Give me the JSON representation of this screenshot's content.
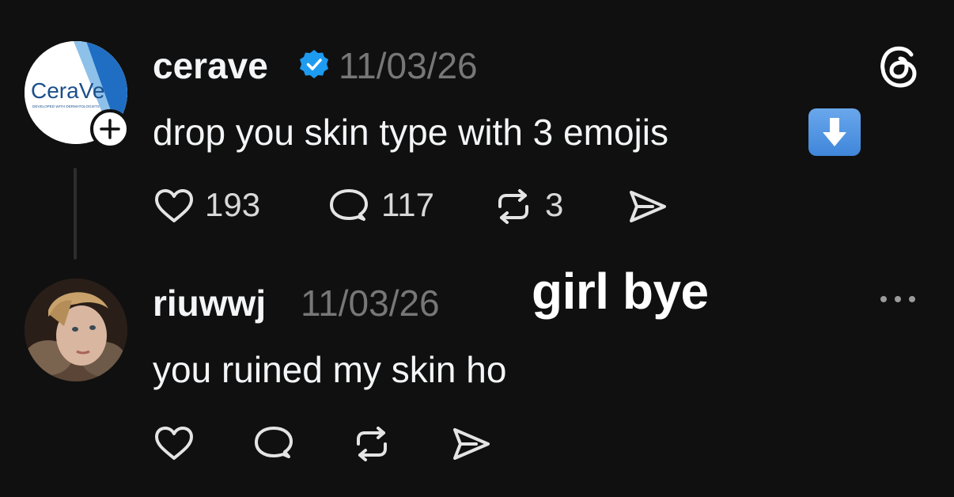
{
  "post": {
    "username": "cerave",
    "verified": true,
    "timestamp": "11/03/26",
    "text": "drop you skin type with 3 emojis",
    "text_emoji": "down-arrow-emoji",
    "avatar_logo_text": "CeraVe",
    "avatar_logo_subtext": "DEVELOPED WITH DERMATOLOGISTS",
    "likes": "193",
    "replies": "117",
    "reposts": "3",
    "accent_color": "#1d9bf0"
  },
  "reply": {
    "username": "riuwwj",
    "timestamp": "11/03/26",
    "text": "you ruined my skin ho"
  },
  "caption": "girl bye",
  "icons": {
    "app": "threads-icon",
    "more": "more-icon",
    "like": "heart-icon",
    "reply": "comment-icon",
    "repost": "repost-icon",
    "share": "send-icon"
  }
}
